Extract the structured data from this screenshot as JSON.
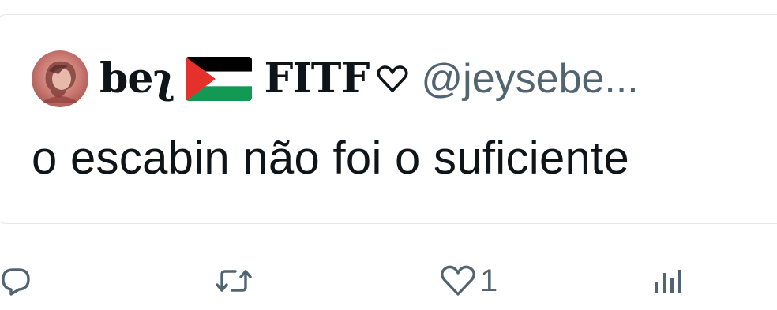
{
  "quoted_tweet": {
    "author": {
      "display_name": "beʅ",
      "flag_icon": "palestine-flag-icon",
      "display_name_suffix": "FITF",
      "heart_icon": "heart-outline-icon",
      "handle": "@jeysebe..."
    },
    "text": "o escabin não foi o suficiente"
  },
  "actions": {
    "reply_icon": "reply-icon",
    "retweet_icon": "retweet-icon",
    "like_icon": "like-icon",
    "like_count": "1",
    "views_icon": "views-icon"
  },
  "colors": {
    "text_primary": "#0f1419",
    "text_secondary": "#536471",
    "border": "#e4e7ea",
    "flag_red": "#e4312b",
    "flag_green": "#149954",
    "flag_black": "#000000"
  }
}
